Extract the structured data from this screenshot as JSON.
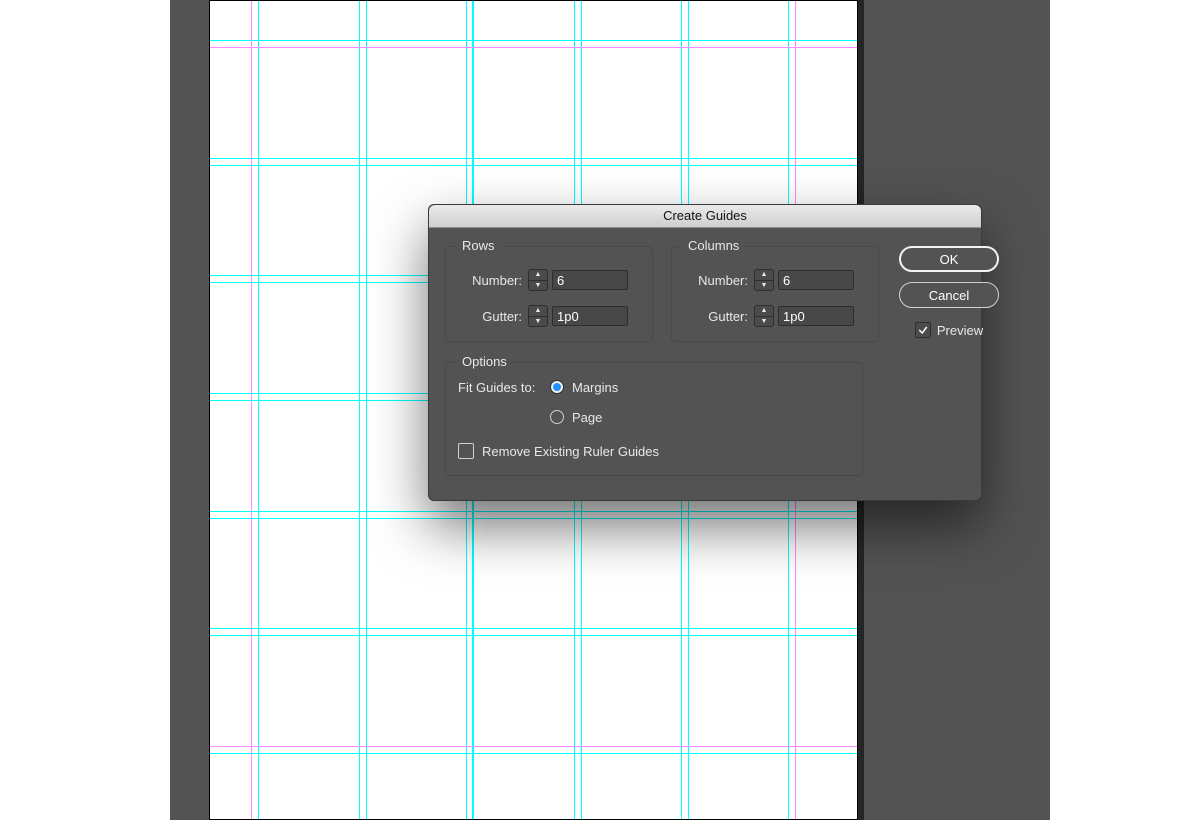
{
  "dialog": {
    "title": "Create Guides",
    "rows": {
      "title": "Rows",
      "number_label": "Number:",
      "number_value": "6",
      "gutter_label": "Gutter:",
      "gutter_value": "1p0"
    },
    "columns": {
      "title": "Columns",
      "number_label": "Number:",
      "number_value": "6",
      "gutter_label": "Gutter:",
      "gutter_value": "1p0"
    },
    "buttons": {
      "ok": "OK",
      "cancel": "Cancel"
    },
    "preview": {
      "label": "Preview",
      "checked": true
    },
    "options": {
      "title": "Options",
      "fit_label": "Fit Guides to:",
      "opt_margins": "Margins",
      "opt_page": "Page",
      "selected": "margins",
      "remove_label": "Remove Existing Ruler Guides",
      "remove_checked": false
    }
  },
  "guides": {
    "vertical_cyan": [
      41,
      48,
      149,
      156,
      256,
      263,
      262,
      364,
      371,
      471,
      478,
      578,
      585
    ],
    "vertical_magenta": [
      41,
      585
    ],
    "horizontal_cyan": [
      39,
      46,
      157,
      164,
      274,
      281,
      392,
      399,
      510,
      517,
      627,
      634,
      745,
      752
    ],
    "horizontal_magenta": [
      46,
      745
    ]
  }
}
